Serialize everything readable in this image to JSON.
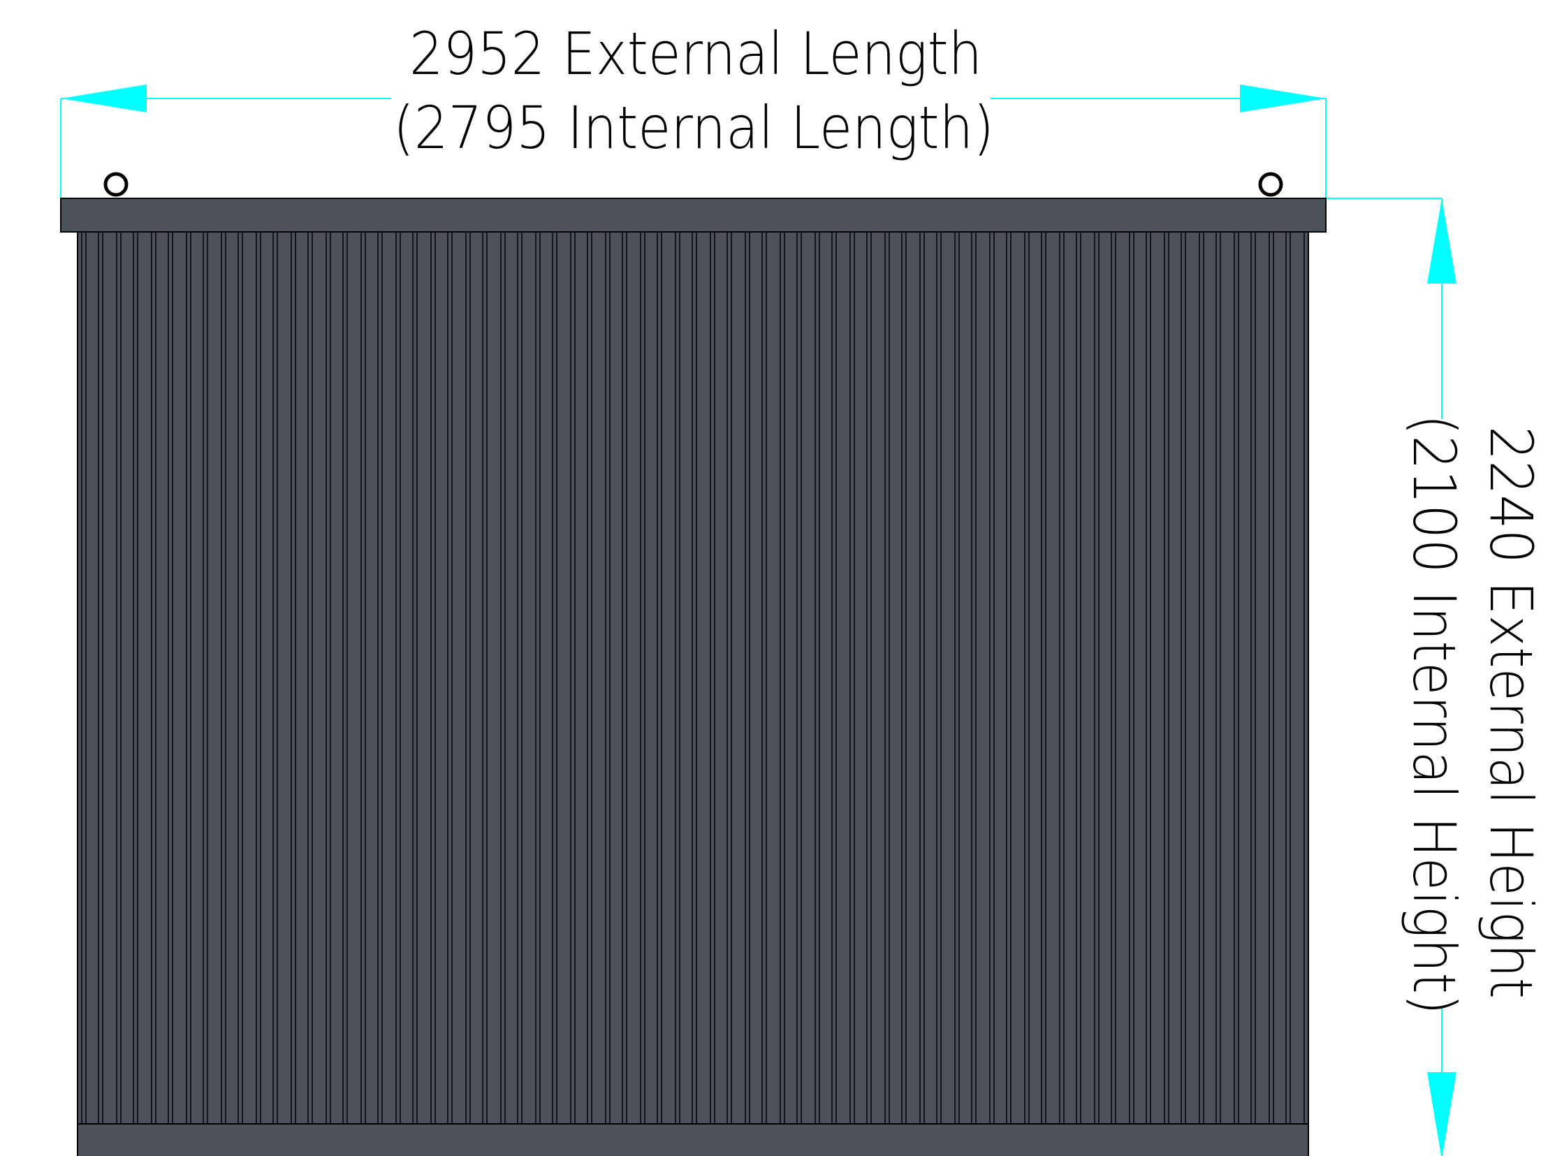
{
  "dimensions": {
    "length": {
      "external_label": "2952 External Length",
      "internal_label": "(2795 Internal Length)"
    },
    "height": {
      "external_label": "2240 External Height",
      "internal_label": "(2100 Internal Height)"
    }
  },
  "colors": {
    "dimension_line": "#00FFFF",
    "container_body": "#4E525B",
    "outline": "#000000",
    "background": "#FFFFFF"
  }
}
